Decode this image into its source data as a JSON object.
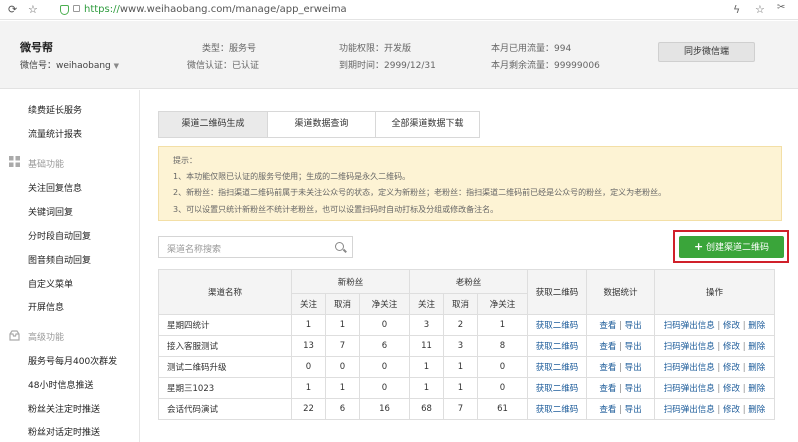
{
  "browser": {
    "url_scheme": "https://",
    "url_rest": "www.weihaobang.com/manage/app_erweima"
  },
  "header": {
    "account_name": "微号帮",
    "wechat_id_label": "微信号：weihaobang",
    "type_label": "类型：服务号",
    "verify_label": "微信认证：已认证",
    "permission_label": "功能权限：开发版",
    "expiry_label": "到期时间：2999/12/31",
    "traffic_used_label": "本月已用流量：994",
    "traffic_left_label": "本月剩余流量：99999006",
    "sync_button": "同步微信端"
  },
  "sidebar": {
    "top_items": [
      "续费延长服务",
      "流量统计报表"
    ],
    "group_basic": "基础功能",
    "basic_items": [
      "关注回复信息",
      "关键词回复",
      "分时段自动回复",
      "图音频自动回复",
      "自定义菜单",
      "开屏信息"
    ],
    "group_advanced": "高级功能",
    "advanced_items": [
      "服务号每月400次群发",
      "48小时信息推送",
      "粉丝关注定时推送",
      "粉丝对话定时推送"
    ]
  },
  "tabs": [
    "渠道二维码生成",
    "渠道数据查询",
    "全部渠道数据下载"
  ],
  "tips": {
    "title": "提示：",
    "lines": [
      "1、本功能仅限已认证的服务号使用；生成的二维码是永久二维码。",
      "2、新粉丝：指扫渠道二维码前属于未关注公众号的状态，定义为新粉丝；老粉丝：指扫渠道二维码前已经是公众号的粉丝，定义为老粉丝。",
      "3、可以设置只统计新粉丝不统计老粉丝，也可以设置扫码时自动打标及分组或修改备注名。"
    ]
  },
  "search": {
    "placeholder": "渠道名称搜索"
  },
  "create_button": "创建渠道二维码",
  "table": {
    "col_name": "渠道名称",
    "col_new": "新粉丝",
    "col_old": "老粉丝",
    "col_get": "获取二维码",
    "col_stats": "数据统计",
    "col_ops": "操作",
    "sub": [
      "关注",
      "取消",
      "净关注"
    ],
    "link_get": "获取二维码",
    "link_view": "查看",
    "link_export": "导出",
    "link_popup": "扫码弹出信息",
    "link_edit": "修改",
    "link_delete": "删除",
    "link_sep": "|",
    "rows": [
      {
        "name": "星期四统计",
        "n": [
          "1",
          "1",
          "0"
        ],
        "o": [
          "3",
          "2",
          "1"
        ]
      },
      {
        "name": "接入客服测试",
        "n": [
          "13",
          "7",
          "6"
        ],
        "o": [
          "11",
          "3",
          "8"
        ]
      },
      {
        "name": "测试二维码升级",
        "n": [
          "0",
          "0",
          "0"
        ],
        "o": [
          "1",
          "1",
          "0"
        ]
      },
      {
        "name": "星期三1023",
        "n": [
          "1",
          "1",
          "0"
        ],
        "o": [
          "1",
          "1",
          "0"
        ]
      },
      {
        "name": "会话代码演试",
        "n": [
          "22",
          "6",
          "16"
        ],
        "o": [
          "68",
          "7",
          "61"
        ]
      }
    ]
  }
}
